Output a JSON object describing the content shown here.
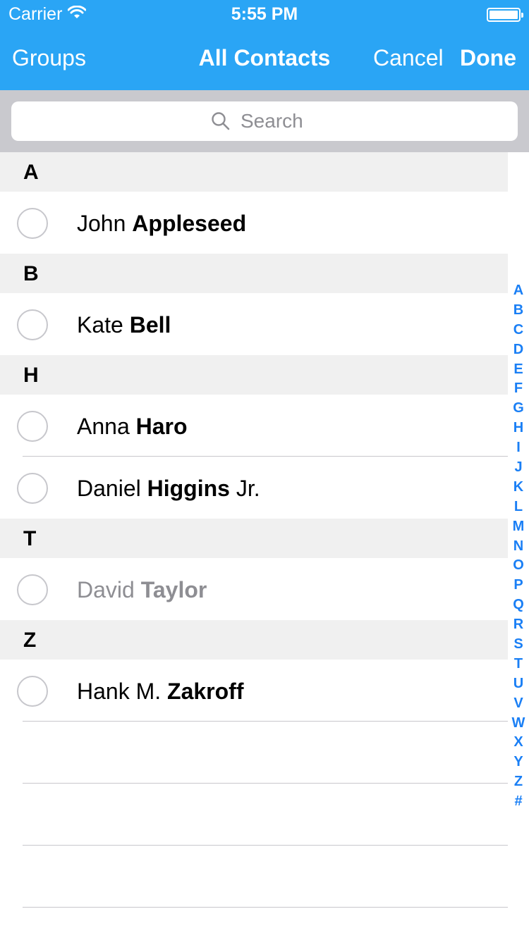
{
  "status_bar": {
    "carrier": "Carrier",
    "time": "5:55 PM"
  },
  "nav": {
    "left_label": "Groups",
    "title": "All Contacts",
    "cancel_label": "Cancel",
    "done_label": "Done"
  },
  "search": {
    "placeholder": "Search"
  },
  "sections": [
    {
      "letter": "A",
      "contacts": [
        {
          "first": "John",
          "last": "Appleseed",
          "suffix": ""
        }
      ]
    },
    {
      "letter": "B",
      "contacts": [
        {
          "first": "Kate",
          "last": "Bell",
          "suffix": ""
        }
      ]
    },
    {
      "letter": "H",
      "contacts": [
        {
          "first": "Anna",
          "last": "Haro",
          "suffix": ""
        },
        {
          "first": "Daniel",
          "last": "Higgins",
          "suffix": "Jr."
        }
      ]
    },
    {
      "letter": "T",
      "contacts": [
        {
          "first": "David",
          "last": "Taylor",
          "suffix": ""
        }
      ]
    },
    {
      "letter": "Z",
      "contacts": [
        {
          "first": "Hank M.",
          "last": "Zakroff",
          "suffix": ""
        }
      ]
    }
  ],
  "index_letters": [
    "A",
    "B",
    "C",
    "D",
    "E",
    "F",
    "G",
    "H",
    "I",
    "J",
    "K",
    "L",
    "M",
    "N",
    "O",
    "P",
    "Q",
    "R",
    "S",
    "T",
    "U",
    "V",
    "W",
    "X",
    "Y",
    "Z",
    "#"
  ],
  "colors": {
    "header": "#2aa5f5",
    "index": "#1a7ff5",
    "section_bg": "#f0f0f0",
    "search_bar_bg": "#c9c9ce",
    "disabled_text": "#8e8e93"
  }
}
